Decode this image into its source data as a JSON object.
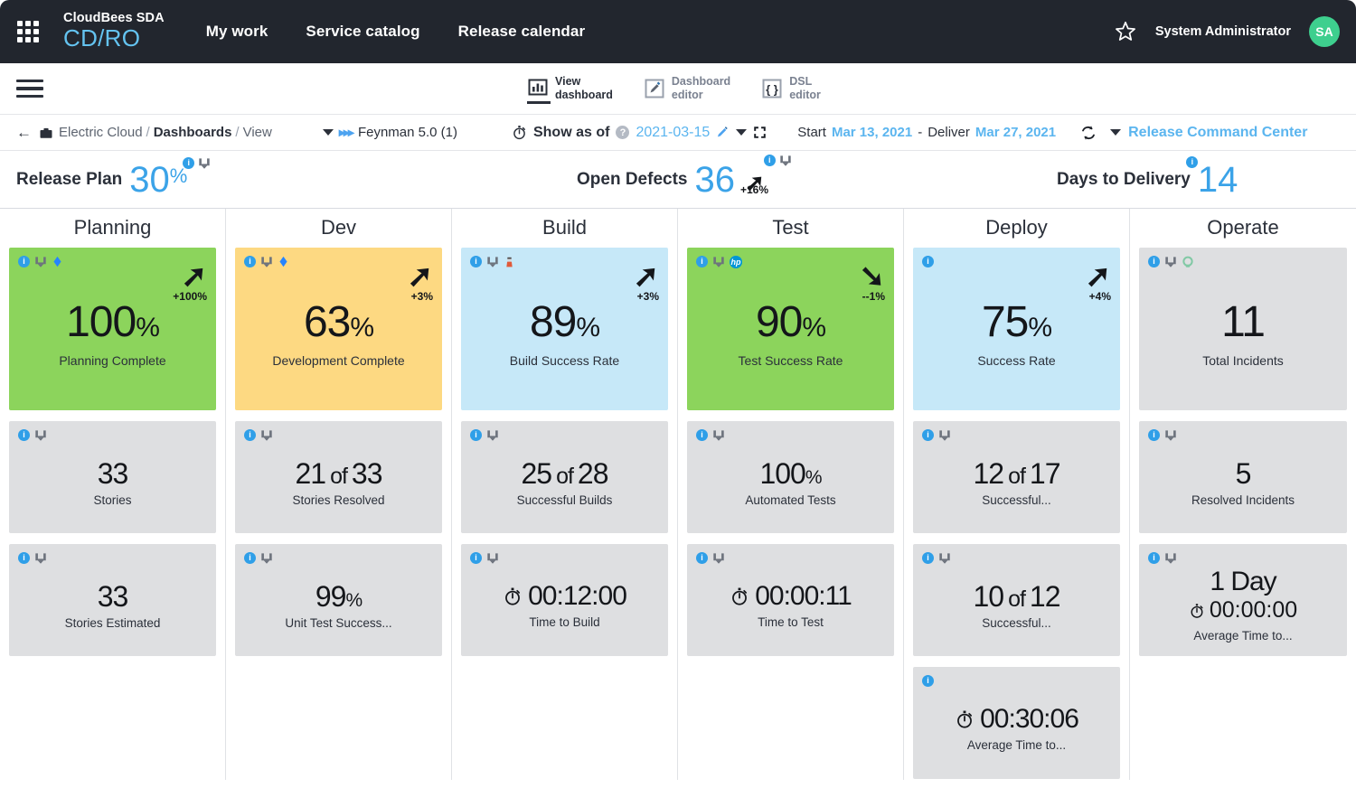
{
  "topnav": {
    "grid_icon": "apps-grid-icon",
    "brand_top": "CloudBees SDA",
    "brand_bottom": "CD/RO",
    "links": [
      {
        "label": "My work"
      },
      {
        "label": "Service catalog"
      },
      {
        "label": "Release calendar"
      }
    ],
    "star_icon": "star-outline-icon",
    "username": "System Administrator",
    "avatar_initials": "SA",
    "avatar_color": "#3ecf8e",
    "background": "#22262e",
    "brand_accent": "#64c3f0"
  },
  "toolbar": {
    "menu_icon": "hamburger-menu-icon",
    "buttons": [
      {
        "icon": "bar-chart-icon",
        "line1": "View",
        "line2": "dashboard",
        "active": true
      },
      {
        "icon": "pencil-edit-icon",
        "line1": "Dashboard",
        "line2": "editor",
        "active": false
      },
      {
        "icon": "code-braces-icon",
        "line1": "DSL",
        "line2": "editor",
        "active": false
      }
    ]
  },
  "breadcrumb": {
    "back_icon": "back-arrow-icon",
    "briefcase_icon": "briefcase-icon",
    "crumb1": "Electric Cloud",
    "sep1": "/",
    "crumb2": "Dashboards",
    "sep2": "/",
    "crumb3": "View",
    "release_caret_icon": "chevron-down-icon",
    "release_chevrons_icon": "double-chevron-icon",
    "release_name": "Feynman 5.0 (1)",
    "show_as_of_icon": "stopwatch-icon",
    "show_as_of_label": "Show as of",
    "help_icon": "?",
    "as_of_date": "2021-03-15",
    "edit_icon": "pencil-icon",
    "dropdown_icon": "chevron-down-icon",
    "fullscreen_icon": "expand-icon",
    "start_label": "Start",
    "start_date": "Mar 13, 2021",
    "dash": "-",
    "deliver_label": "Deliver",
    "deliver_date": "Mar 27, 2021",
    "refresh_icon": "refresh-icon",
    "view_caret_icon": "chevron-down-icon",
    "view_name": "Release Command Center"
  },
  "summary": [
    {
      "label": "Release Plan",
      "value": "30",
      "suffix": "%",
      "icons": [
        "info-icon",
        "download-icon"
      ],
      "trend": "",
      "delta": ""
    },
    {
      "label": "Open Defects",
      "value": "36",
      "suffix": "",
      "icons": [
        "info-icon",
        "download-icon"
      ],
      "trend": "up",
      "delta": "+16%"
    },
    {
      "label": "Days to Delivery",
      "value": "14",
      "suffix": "",
      "icons": [
        "info-icon"
      ],
      "trend": "",
      "delta": ""
    }
  ],
  "columns": [
    {
      "title": "Planning",
      "cards": [
        {
          "size": "big",
          "color": "green",
          "icons": [
            "info-icon",
            "download-icon",
            "jira-icon"
          ],
          "value": "100",
          "pct": "%",
          "caption": "Planning Complete",
          "trend": "up",
          "delta": "+100%"
        },
        {
          "size": "small",
          "color": "grey",
          "icons": [
            "info-icon",
            "download-icon"
          ],
          "value": "33",
          "pct": "",
          "caption": "Stories"
        },
        {
          "size": "small",
          "color": "grey",
          "icons": [
            "info-icon",
            "download-icon"
          ],
          "value": "33",
          "pct": "",
          "caption": "Stories Estimated"
        }
      ]
    },
    {
      "title": "Dev",
      "cards": [
        {
          "size": "big",
          "color": "amber",
          "icons": [
            "info-icon",
            "download-icon",
            "jira-icon"
          ],
          "value": "63",
          "pct": "%",
          "caption": "Development Complete",
          "trend": "up",
          "delta": "+3%"
        },
        {
          "size": "small",
          "color": "grey",
          "icons": [
            "info-icon",
            "download-icon"
          ],
          "value": "21",
          "of": "of",
          "value2": "33",
          "caption": "Stories Resolved"
        },
        {
          "size": "small",
          "color": "grey",
          "icons": [
            "info-icon",
            "download-icon"
          ],
          "value": "99",
          "pct": "%",
          "caption": "Unit Test Success..."
        }
      ]
    },
    {
      "title": "Build",
      "cards": [
        {
          "size": "big",
          "color": "blue",
          "icons": [
            "info-icon",
            "download-icon",
            "jenkins-icon"
          ],
          "value": "89",
          "pct": "%",
          "caption": "Build Success Rate",
          "trend": "up",
          "delta": "+3%"
        },
        {
          "size": "small",
          "color": "grey",
          "icons": [
            "info-icon",
            "download-icon"
          ],
          "value": "25",
          "of": "of",
          "value2": "28",
          "caption": "Successful Builds"
        },
        {
          "size": "small",
          "color": "grey",
          "icons": [
            "info-icon",
            "download-icon"
          ],
          "timer": "00:12:00",
          "caption": "Time to Build"
        }
      ]
    },
    {
      "title": "Test",
      "cards": [
        {
          "size": "big",
          "color": "green",
          "icons": [
            "info-icon",
            "download-icon",
            "hp-icon"
          ],
          "value": "90",
          "pct": "%",
          "caption": "Test Success Rate",
          "trend": "down",
          "delta": "--1%"
        },
        {
          "size": "small",
          "color": "grey",
          "icons": [
            "info-icon",
            "download-icon"
          ],
          "value": "100",
          "pct": "%",
          "caption": "Automated Tests"
        },
        {
          "size": "small",
          "color": "grey",
          "icons": [
            "info-icon",
            "download-icon"
          ],
          "timer": "00:00:11",
          "caption": "Time to Test"
        }
      ]
    },
    {
      "title": "Deploy",
      "cards": [
        {
          "size": "big",
          "color": "blue",
          "icons": [
            "info-icon"
          ],
          "value": "75",
          "pct": "%",
          "caption": "Success Rate",
          "trend": "up",
          "delta": "+4%"
        },
        {
          "size": "small",
          "color": "grey",
          "icons": [
            "info-icon",
            "download-icon"
          ],
          "value": "12",
          "of": "of",
          "value2": "17",
          "caption": "Successful..."
        },
        {
          "size": "small",
          "color": "grey",
          "icons": [
            "info-icon",
            "download-icon"
          ],
          "value": "10",
          "of": "of",
          "value2": "12",
          "caption": "Successful..."
        },
        {
          "size": "small",
          "color": "grey",
          "icons": [
            "info-icon"
          ],
          "timer": "00:30:06",
          "caption": "Average Time to..."
        }
      ]
    },
    {
      "title": "Operate",
      "cards": [
        {
          "size": "big",
          "color": "grey",
          "icons": [
            "info-icon",
            "download-icon",
            "servicenow-icon"
          ],
          "value": "11",
          "pct": "",
          "caption": "Total Incidents"
        },
        {
          "size": "small",
          "color": "grey",
          "icons": [
            "info-icon",
            "download-icon"
          ],
          "value": "5",
          "pct": "",
          "caption": "Resolved Incidents"
        },
        {
          "size": "small",
          "color": "grey",
          "icons": [
            "info-icon",
            "download-icon"
          ],
          "day": "1 Day",
          "timer": "00:00:00",
          "caption": "Average Time to..."
        }
      ]
    }
  ],
  "colors": {
    "green": "#8cd45c",
    "amber": "#fdd982",
    "blue": "#c6e8f8",
    "grey": "#dedfe1",
    "accent_blue": "#3ba3e8",
    "nav_dark": "#22262e"
  }
}
